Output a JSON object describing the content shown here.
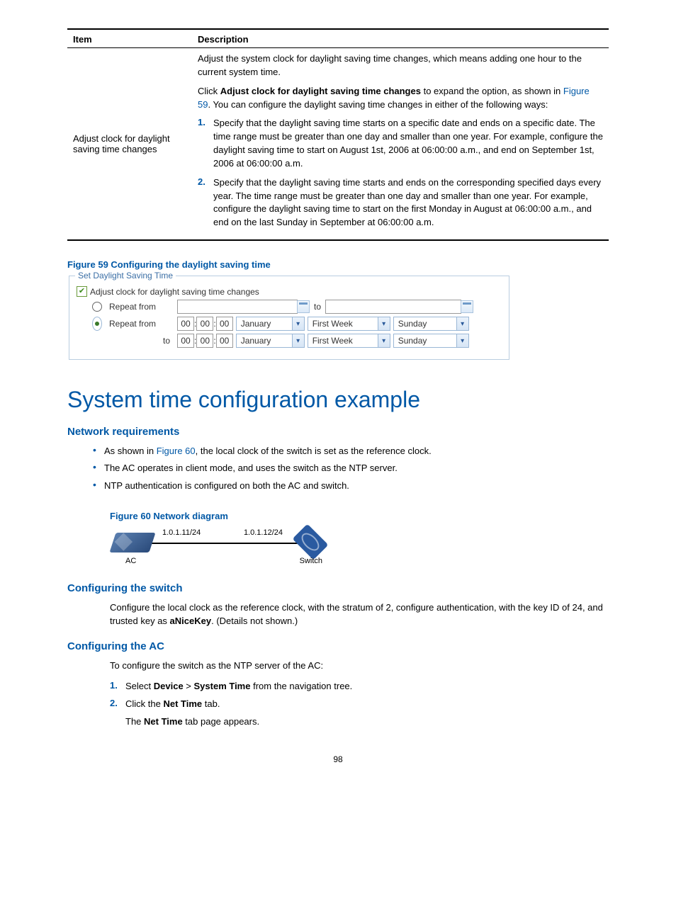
{
  "table": {
    "headers": {
      "item": "Item",
      "desc": "Description"
    },
    "row": {
      "item": "Adjust clock for daylight saving time changes",
      "p1": "Adjust the system clock for daylight saving time changes, which means adding one hour to the current system time.",
      "p2a": "Click ",
      "p2b": "Adjust clock for daylight saving time changes",
      "p2c": " to expand the option, as shown in ",
      "p2link": "Figure 59",
      "p2d": ". You can configure the daylight saving time changes in either of the following ways:",
      "li1": "Specify that the daylight saving time starts on a specific date and ends on a specific date. The time range must be greater than one day and smaller than one year. For example, configure the daylight saving time to start on August 1st, 2006 at 06:00:00 a.m., and end on September 1st, 2006 at 06:00:00 a.m.",
      "li2": "Specify that the daylight saving time starts and ends on the corresponding specified days every year. The time range must be greater than one day and smaller than one year. For example, configure the daylight saving time to start on the first Monday in August at 06:00:00 a.m., and end on the last Sunday in September at 06:00:00 a.m."
    }
  },
  "fig59": {
    "caption": "Figure 59 Configuring the daylight saving time",
    "legend": "Set Daylight Saving Time",
    "checkbox": "Adjust clock for daylight saving time changes",
    "repeat_from": "Repeat  from",
    "to": "to",
    "hh": "00",
    "mm": "00",
    "ss": "00",
    "month": "January",
    "week": "First Week",
    "day": "Sunday"
  },
  "h1": "System time configuration example",
  "netreq": {
    "title": "Network requirements",
    "b1a": "As shown in ",
    "b1link": "Figure 60",
    "b1b": ", the local clock of the switch is set as the reference clock.",
    "b2": "The AC operates in client mode, and uses the switch as the NTP server.",
    "b3": "NTP authentication is configured on both the AC and switch."
  },
  "fig60": {
    "caption": "Figure 60 Network diagram",
    "ip_ac": "1.0.1.11/24",
    "ip_sw": "1.0.1.12/24",
    "lbl_ac": "AC",
    "lbl_sw": "Switch"
  },
  "cfg_switch": {
    "title": "Configuring the switch",
    "p_a": "Configure the local clock as the reference clock, with the stratum of 2, configure authentication, with the key ID of 24, and trusted key as ",
    "p_b": "aNiceKey",
    "p_c": ". (Details not shown.)"
  },
  "cfg_ac": {
    "title": "Configuring the AC",
    "intro": "To configure the switch as the NTP server of the AC:",
    "s1a": "Select ",
    "s1b": "Device",
    "s1c": " > ",
    "s1d": "System Time",
    "s1e": " from the navigation tree.",
    "s2a": "Click the ",
    "s2b": "Net Time",
    "s2c": " tab.",
    "s2sub_a": "The ",
    "s2sub_b": "Net Time",
    "s2sub_c": " tab page appears."
  },
  "page": "98"
}
